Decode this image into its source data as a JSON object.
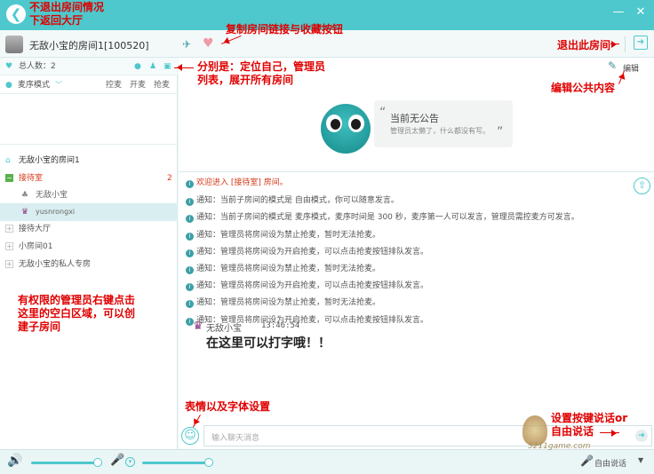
{
  "window": {
    "minimize_icon": "minimize-icon",
    "close_icon": "close-icon"
  },
  "room": {
    "title": "无敌小宝的房间1[100520]",
    "edit_label": "编辑"
  },
  "members": {
    "total_label": "总人数：2"
  },
  "mic": {
    "mode_label": "麦序模式",
    "actions": [
      "控麦",
      "开麦",
      "抢麦"
    ]
  },
  "tree": {
    "root": "无敌小宝的房间1",
    "channels": [
      {
        "name": "接待室",
        "count": "2",
        "expanded": true
      },
      {
        "name": "接待大厅"
      },
      {
        "name": "小房间01"
      },
      {
        "name": "无敌小宝的私人专房"
      }
    ],
    "users": [
      "无敌小宝",
      "yusnrongxi"
    ]
  },
  "announcement": {
    "title": "当前无公告",
    "subtitle": "管理员太懒了，什么都没有写。"
  },
  "chat": {
    "welcome": "欢迎进入 [接待室] 房间。",
    "notices": [
      "通知：当前子房间的模式是 自由模式，你可以随意发言。",
      "通知：当前子房间的模式是 麦序模式，麦序时间是 300 秒，麦序第一人可以发言，管理员需控麦方可发言。",
      "通知：管理员将房间设为禁止抢麦，暂时无法抢麦。",
      "通知：管理员将房间设为开启抢麦，可以点击抢麦按钮排队发言。",
      "通知：管理员将房间设为禁止抢麦，暂时无法抢麦。",
      "通知：管理员将房间设为开启抢麦，可以点击抢麦按钮排队发言。",
      "通知：管理员将房间设为禁止抢麦，暂时无法抢麦。",
      "通知：管理员将房间设为开启抢麦，可以点击抢麦按钮排队发言。"
    ],
    "message": {
      "user": "无敌小宝",
      "time": "13:46:54",
      "text": "在这里可以打字哦！！"
    },
    "input_placeholder": "输入聊天消息",
    "talk_mode": "自由说话"
  },
  "annotations": {
    "back": "不退出房间情况下返回大厅",
    "copy": "复制房间链接与收藏按钮",
    "exit": "退出此房间",
    "icons": "分别是：定位自己，管理员列表，展开所有房间",
    "edit": "编辑公共内容",
    "admin": "有权限的管理员右键点击这里的空白区域，可以创建子房间",
    "emoji": "表情以及字体设置",
    "talk": "设置按键说话or 自由说话"
  },
  "watermark": {
    "text": "5211game.com"
  },
  "colors": {
    "accent": "#4ec8cc",
    "annotation": "#e00000",
    "channel_active": "#d43a1a"
  }
}
